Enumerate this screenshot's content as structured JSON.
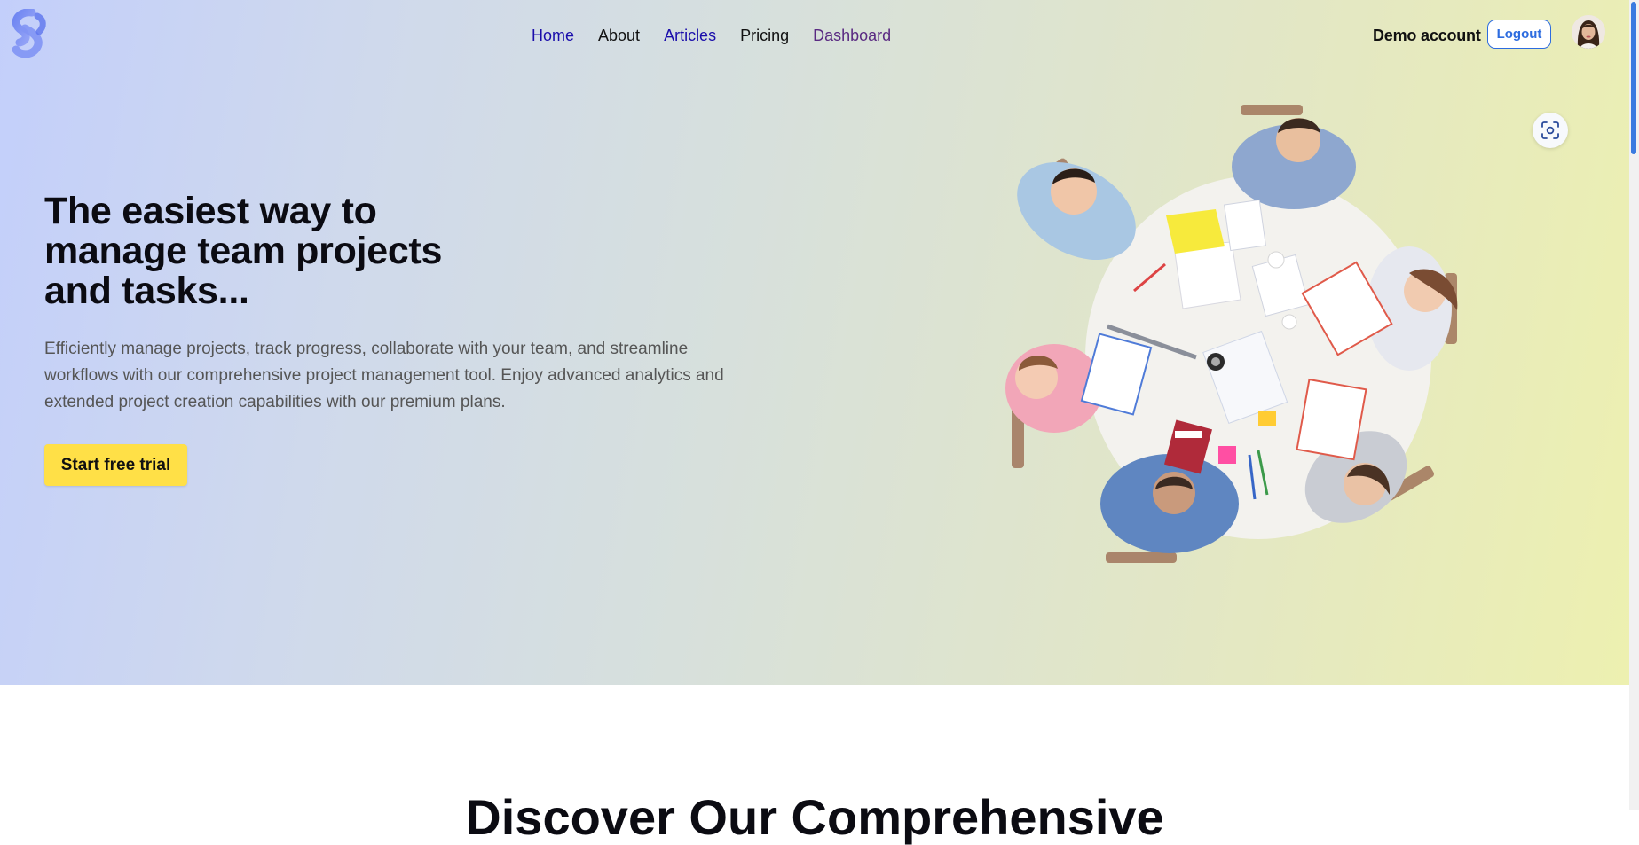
{
  "nav": {
    "items": [
      {
        "label": "Home"
      },
      {
        "label": "About"
      },
      {
        "label": "Articles"
      },
      {
        "label": "Pricing"
      },
      {
        "label": "Dashboard"
      }
    ]
  },
  "account": {
    "name": "Demo account",
    "logout_label": "Logout"
  },
  "hero": {
    "headline": "The easiest way to manage team projects and tasks...",
    "description": "Efficiently manage projects, track progress, collaborate with your team, and streamline workflows with our comprehensive project management tool. Enjoy advanced analytics and extended project creation capabilities with our premium plans.",
    "cta_label": "Start free trial"
  },
  "next_section": {
    "title_partial": "Discover Our Comprehensive"
  },
  "icons": {
    "logo": "brand-logo",
    "scan": "scan-icon",
    "avatar": "user-avatar"
  },
  "colors": {
    "cta": "#ffe047",
    "logout_border": "#2d6cdf",
    "link_blue": "#1a0dab",
    "link_visited": "#5a2a82",
    "scroll_thumb": "#3a7be0"
  }
}
